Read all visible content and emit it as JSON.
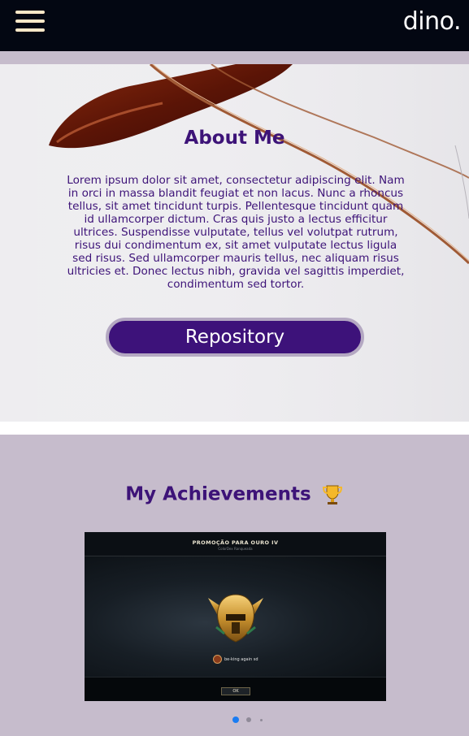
{
  "header": {
    "menu_icon": "hamburger-icon",
    "brand": "dino."
  },
  "about": {
    "title": "About Me",
    "text": "Lorem ipsum dolor sit amet, consectetur adipiscing elit. Nam in orci in massa blandit feugiat et non lacus. Nunc a rhoncus tellus, sit amet tincidunt turpis. Pellentesque tincidunt quam id ullamcorper dictum. Cras quis justo a lectus efficitur ultrices. Suspendisse vulputate, tellus vel volutpat rutrum, risus dui condimentum ex, sit amet vulputate lectus ligula sed risus. Sed ullamcorper mauris tellus, nec aliquam risus ultricies et. Donec lectus nibh, gravida vel sagittis imperdiet, condimentum sed tortor.",
    "button_label": "Repository",
    "background_image": "eyeglasses-photo"
  },
  "achievements": {
    "title": "My Achievements",
    "title_icon": "trophy-icon",
    "slide": {
      "title": "PROMOÇÃO PARA OURO IV",
      "subtitle": "ColorDex Ranqueada",
      "player_name": "be-king again sd",
      "ok_label": "OK",
      "crest_icon": "gold-rank-crest-icon"
    },
    "carousel": {
      "total": 3,
      "active": 1
    }
  },
  "colors": {
    "topbar": "#030712",
    "accent": "#3d1378",
    "button": "#3d127a",
    "section_bg": "#c6bccc",
    "active_dot": "#1a7cf2"
  }
}
